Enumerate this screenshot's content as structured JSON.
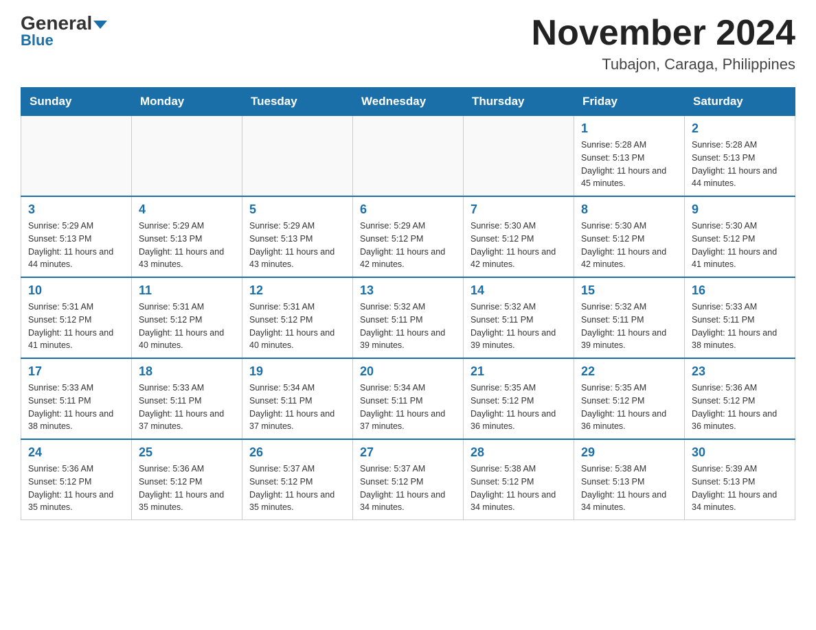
{
  "header": {
    "logo_general": "General",
    "logo_blue": "Blue",
    "month_year": "November 2024",
    "location": "Tubajon, Caraga, Philippines"
  },
  "days_of_week": [
    "Sunday",
    "Monday",
    "Tuesday",
    "Wednesday",
    "Thursday",
    "Friday",
    "Saturday"
  ],
  "weeks": [
    [
      {
        "num": "",
        "sunrise": "",
        "sunset": "",
        "daylight": ""
      },
      {
        "num": "",
        "sunrise": "",
        "sunset": "",
        "daylight": ""
      },
      {
        "num": "",
        "sunrise": "",
        "sunset": "",
        "daylight": ""
      },
      {
        "num": "",
        "sunrise": "",
        "sunset": "",
        "daylight": ""
      },
      {
        "num": "",
        "sunrise": "",
        "sunset": "",
        "daylight": ""
      },
      {
        "num": "1",
        "sunrise": "Sunrise: 5:28 AM",
        "sunset": "Sunset: 5:13 PM",
        "daylight": "Daylight: 11 hours and 45 minutes."
      },
      {
        "num": "2",
        "sunrise": "Sunrise: 5:28 AM",
        "sunset": "Sunset: 5:13 PM",
        "daylight": "Daylight: 11 hours and 44 minutes."
      }
    ],
    [
      {
        "num": "3",
        "sunrise": "Sunrise: 5:29 AM",
        "sunset": "Sunset: 5:13 PM",
        "daylight": "Daylight: 11 hours and 44 minutes."
      },
      {
        "num": "4",
        "sunrise": "Sunrise: 5:29 AM",
        "sunset": "Sunset: 5:13 PM",
        "daylight": "Daylight: 11 hours and 43 minutes."
      },
      {
        "num": "5",
        "sunrise": "Sunrise: 5:29 AM",
        "sunset": "Sunset: 5:13 PM",
        "daylight": "Daylight: 11 hours and 43 minutes."
      },
      {
        "num": "6",
        "sunrise": "Sunrise: 5:29 AM",
        "sunset": "Sunset: 5:12 PM",
        "daylight": "Daylight: 11 hours and 42 minutes."
      },
      {
        "num": "7",
        "sunrise": "Sunrise: 5:30 AM",
        "sunset": "Sunset: 5:12 PM",
        "daylight": "Daylight: 11 hours and 42 minutes."
      },
      {
        "num": "8",
        "sunrise": "Sunrise: 5:30 AM",
        "sunset": "Sunset: 5:12 PM",
        "daylight": "Daylight: 11 hours and 42 minutes."
      },
      {
        "num": "9",
        "sunrise": "Sunrise: 5:30 AM",
        "sunset": "Sunset: 5:12 PM",
        "daylight": "Daylight: 11 hours and 41 minutes."
      }
    ],
    [
      {
        "num": "10",
        "sunrise": "Sunrise: 5:31 AM",
        "sunset": "Sunset: 5:12 PM",
        "daylight": "Daylight: 11 hours and 41 minutes."
      },
      {
        "num": "11",
        "sunrise": "Sunrise: 5:31 AM",
        "sunset": "Sunset: 5:12 PM",
        "daylight": "Daylight: 11 hours and 40 minutes."
      },
      {
        "num": "12",
        "sunrise": "Sunrise: 5:31 AM",
        "sunset": "Sunset: 5:12 PM",
        "daylight": "Daylight: 11 hours and 40 minutes."
      },
      {
        "num": "13",
        "sunrise": "Sunrise: 5:32 AM",
        "sunset": "Sunset: 5:11 PM",
        "daylight": "Daylight: 11 hours and 39 minutes."
      },
      {
        "num": "14",
        "sunrise": "Sunrise: 5:32 AM",
        "sunset": "Sunset: 5:11 PM",
        "daylight": "Daylight: 11 hours and 39 minutes."
      },
      {
        "num": "15",
        "sunrise": "Sunrise: 5:32 AM",
        "sunset": "Sunset: 5:11 PM",
        "daylight": "Daylight: 11 hours and 39 minutes."
      },
      {
        "num": "16",
        "sunrise": "Sunrise: 5:33 AM",
        "sunset": "Sunset: 5:11 PM",
        "daylight": "Daylight: 11 hours and 38 minutes."
      }
    ],
    [
      {
        "num": "17",
        "sunrise": "Sunrise: 5:33 AM",
        "sunset": "Sunset: 5:11 PM",
        "daylight": "Daylight: 11 hours and 38 minutes."
      },
      {
        "num": "18",
        "sunrise": "Sunrise: 5:33 AM",
        "sunset": "Sunset: 5:11 PM",
        "daylight": "Daylight: 11 hours and 37 minutes."
      },
      {
        "num": "19",
        "sunrise": "Sunrise: 5:34 AM",
        "sunset": "Sunset: 5:11 PM",
        "daylight": "Daylight: 11 hours and 37 minutes."
      },
      {
        "num": "20",
        "sunrise": "Sunrise: 5:34 AM",
        "sunset": "Sunset: 5:11 PM",
        "daylight": "Daylight: 11 hours and 37 minutes."
      },
      {
        "num": "21",
        "sunrise": "Sunrise: 5:35 AM",
        "sunset": "Sunset: 5:12 PM",
        "daylight": "Daylight: 11 hours and 36 minutes."
      },
      {
        "num": "22",
        "sunrise": "Sunrise: 5:35 AM",
        "sunset": "Sunset: 5:12 PM",
        "daylight": "Daylight: 11 hours and 36 minutes."
      },
      {
        "num": "23",
        "sunrise": "Sunrise: 5:36 AM",
        "sunset": "Sunset: 5:12 PM",
        "daylight": "Daylight: 11 hours and 36 minutes."
      }
    ],
    [
      {
        "num": "24",
        "sunrise": "Sunrise: 5:36 AM",
        "sunset": "Sunset: 5:12 PM",
        "daylight": "Daylight: 11 hours and 35 minutes."
      },
      {
        "num": "25",
        "sunrise": "Sunrise: 5:36 AM",
        "sunset": "Sunset: 5:12 PM",
        "daylight": "Daylight: 11 hours and 35 minutes."
      },
      {
        "num": "26",
        "sunrise": "Sunrise: 5:37 AM",
        "sunset": "Sunset: 5:12 PM",
        "daylight": "Daylight: 11 hours and 35 minutes."
      },
      {
        "num": "27",
        "sunrise": "Sunrise: 5:37 AM",
        "sunset": "Sunset: 5:12 PM",
        "daylight": "Daylight: 11 hours and 34 minutes."
      },
      {
        "num": "28",
        "sunrise": "Sunrise: 5:38 AM",
        "sunset": "Sunset: 5:12 PM",
        "daylight": "Daylight: 11 hours and 34 minutes."
      },
      {
        "num": "29",
        "sunrise": "Sunrise: 5:38 AM",
        "sunset": "Sunset: 5:13 PM",
        "daylight": "Daylight: 11 hours and 34 minutes."
      },
      {
        "num": "30",
        "sunrise": "Sunrise: 5:39 AM",
        "sunset": "Sunset: 5:13 PM",
        "daylight": "Daylight: 11 hours and 34 minutes."
      }
    ]
  ]
}
